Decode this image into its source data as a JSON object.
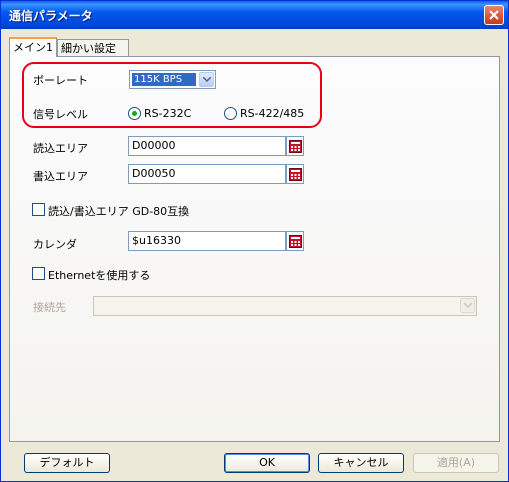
{
  "window": {
    "title": "通信パラメータ"
  },
  "tabs": [
    {
      "label": "メイン1",
      "active": true
    },
    {
      "label": "細かい設定",
      "active": false
    }
  ],
  "baud": {
    "label": "ボーレート",
    "value": "115K BPS"
  },
  "signal": {
    "label": "信号レベル",
    "options": [
      {
        "label": "RS-232C",
        "selected": true
      },
      {
        "label": "RS-422/485",
        "selected": false
      }
    ]
  },
  "read_area": {
    "label": "読込エリア",
    "value": "D00000"
  },
  "write_area": {
    "label": "書込エリア",
    "value": "D00050"
  },
  "gd80": {
    "label": "読込/書込エリア GD-80互換",
    "checked": false
  },
  "calendar": {
    "label": "カレンダ",
    "value": "$u16330"
  },
  "ethernet": {
    "label": "Ethernetを使用する",
    "checked": false
  },
  "destination": {
    "label": "接続先",
    "value": ""
  },
  "buttons": {
    "default": "デフォルト",
    "ok": "OK",
    "cancel": "キャンセル",
    "apply": "適用(A)"
  },
  "colors": {
    "highlight": "#e60012",
    "radio_dot": "#21a121",
    "selection": "#316ac5"
  }
}
